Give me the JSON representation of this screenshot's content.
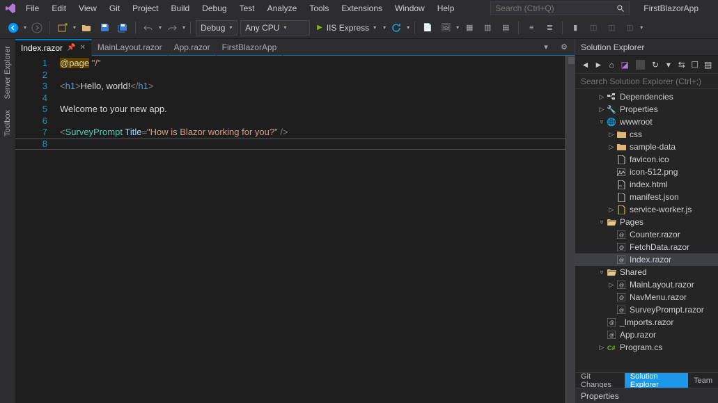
{
  "menubar": [
    "File",
    "Edit",
    "View",
    "Git",
    "Project",
    "Build",
    "Debug",
    "Test",
    "Analyze",
    "Tools",
    "Extensions",
    "Window",
    "Help"
  ],
  "search_placeholder": "Search (Ctrl+Q)",
  "app_title": "FirstBlazorApp",
  "toolbar": {
    "config": "Debug",
    "platform": "Any CPU",
    "run": "IIS Express"
  },
  "vtabs": [
    "Server Explorer",
    "Toolbox"
  ],
  "doc_tabs": [
    {
      "label": "Index.razor",
      "active": true,
      "pinned": true
    },
    {
      "label": "MainLayout.razor"
    },
    {
      "label": "App.razor"
    },
    {
      "label": "FirstBlazorApp"
    }
  ],
  "code_lines": [
    "1",
    "2",
    "3",
    "4",
    "5",
    "6",
    "7",
    "8"
  ],
  "code": {
    "l1_dir": "@page",
    "l1_str": "\"/\"",
    "l3_t1": "<",
    "l3_e": "h1",
    "l3_t2": ">",
    "l3_txt": "Hello, world!",
    "l3_t3": "</",
    "l3_t4": ">",
    "l5": "Welcome to your new app.",
    "l7_t1": "<",
    "l7_c": "SurveyPrompt",
    "l7_a": "Title",
    "l7_eq": "=",
    "l7_s": "\"How is Blazor working for you?\"",
    "l7_t2": " />"
  },
  "solution_explorer": {
    "title": "Solution Explorer",
    "search_placeholder": "Search Solution Explorer (Ctrl+;)",
    "nodes": [
      {
        "indent": 1,
        "arrow": "▷",
        "icon": "dep",
        "label": "Dependencies"
      },
      {
        "indent": 1,
        "arrow": "▷",
        "icon": "wrench",
        "label": "Properties"
      },
      {
        "indent": 1,
        "arrow": "▿",
        "icon": "globe",
        "label": "wwwroot"
      },
      {
        "indent": 2,
        "arrow": "▷",
        "icon": "fold",
        "label": "css"
      },
      {
        "indent": 2,
        "arrow": "▷",
        "icon": "fold",
        "label": "sample-data"
      },
      {
        "indent": 2,
        "arrow": "",
        "icon": "file",
        "label": "favicon.ico"
      },
      {
        "indent": 2,
        "arrow": "",
        "icon": "img",
        "label": "icon-512.png"
      },
      {
        "indent": 2,
        "arrow": "",
        "icon": "html",
        "label": "index.html"
      },
      {
        "indent": 2,
        "arrow": "",
        "icon": "json",
        "label": "manifest.json"
      },
      {
        "indent": 2,
        "arrow": "▷",
        "icon": "js",
        "label": "service-worker.js"
      },
      {
        "indent": 1,
        "arrow": "▿",
        "icon": "fold-o",
        "label": "Pages"
      },
      {
        "indent": 2,
        "arrow": "",
        "icon": "raz",
        "label": "Counter.razor"
      },
      {
        "indent": 2,
        "arrow": "",
        "icon": "raz",
        "label": "FetchData.razor"
      },
      {
        "indent": 2,
        "arrow": "",
        "icon": "raz",
        "label": "Index.razor",
        "selected": true
      },
      {
        "indent": 1,
        "arrow": "▿",
        "icon": "fold-o",
        "label": "Shared"
      },
      {
        "indent": 2,
        "arrow": "▷",
        "icon": "raz",
        "label": "MainLayout.razor"
      },
      {
        "indent": 2,
        "arrow": "",
        "icon": "raz",
        "label": "NavMenu.razor"
      },
      {
        "indent": 2,
        "arrow": "",
        "icon": "raz",
        "label": "SurveyPrompt.razor"
      },
      {
        "indent": 1,
        "arrow": "",
        "icon": "raz",
        "label": "_Imports.razor"
      },
      {
        "indent": 1,
        "arrow": "",
        "icon": "raz",
        "label": "App.razor"
      },
      {
        "indent": 1,
        "arrow": "▷",
        "icon": "cs",
        "label": "Program.cs"
      }
    ]
  },
  "bottom_tabs": [
    "Git Changes",
    "Solution Explorer",
    "Team"
  ],
  "properties_title": "Properties"
}
